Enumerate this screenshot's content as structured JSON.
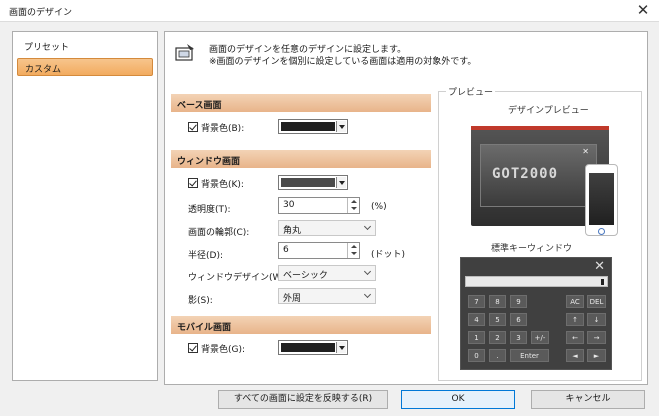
{
  "window": {
    "title": "画面のデザイン"
  },
  "sidebar": {
    "items": [
      {
        "label": "プリセット"
      },
      {
        "label": "カスタム"
      }
    ]
  },
  "description": {
    "line1": "画面のデザインを任意のデザインに設定します。",
    "line2": "※画面のデザインを個別に設定している画面は適用の対象外です。"
  },
  "base": {
    "header": "ベース画面",
    "bg_label": "背景色(B):",
    "bg_color": "#202020"
  },
  "window_screen": {
    "header": "ウィンドウ画面",
    "bg_label": "背景色(K):",
    "bg_color": "#4b4b4b",
    "transparency_label": "透明度(T):",
    "transparency_value": "30",
    "transparency_unit": "(%)",
    "frame_label": "画面の輪郭(C):",
    "frame_value": "角丸",
    "radius_label": "半径(D):",
    "radius_value": "6",
    "radius_unit": "(ドット)",
    "design_label": "ウィンドウデザイン(W):",
    "design_value": "ベーシック",
    "shadow_label": "影(S):",
    "shadow_value": "外周"
  },
  "mobile": {
    "header": "モバイル画面",
    "bg_label": "背景色(G):",
    "bg_color": "#202020"
  },
  "preview": {
    "group_label": "プレビュー",
    "design_preview_label": "デザインプレビュー",
    "logo_text": "GOT2000",
    "keypad_label": "標準キーウィンドウ",
    "keys": [
      [
        "7",
        "8",
        "9",
        "AC",
        "DEL"
      ],
      [
        "4",
        "5",
        "6",
        "↑",
        "↓"
      ],
      [
        "1",
        "2",
        "3",
        "+/-",
        "←",
        "→"
      ],
      [
        "0",
        ".",
        "Enter",
        "◄",
        "►"
      ]
    ]
  },
  "footer": {
    "apply_all_label": "すべての画面に設定を反映する(R)",
    "ok_label": "OK",
    "cancel_label": "キャンセル"
  },
  "colors": {
    "accent_orange": "#f2ab5f",
    "section_header": "#e8b48a",
    "ok_border": "#0078d7"
  }
}
